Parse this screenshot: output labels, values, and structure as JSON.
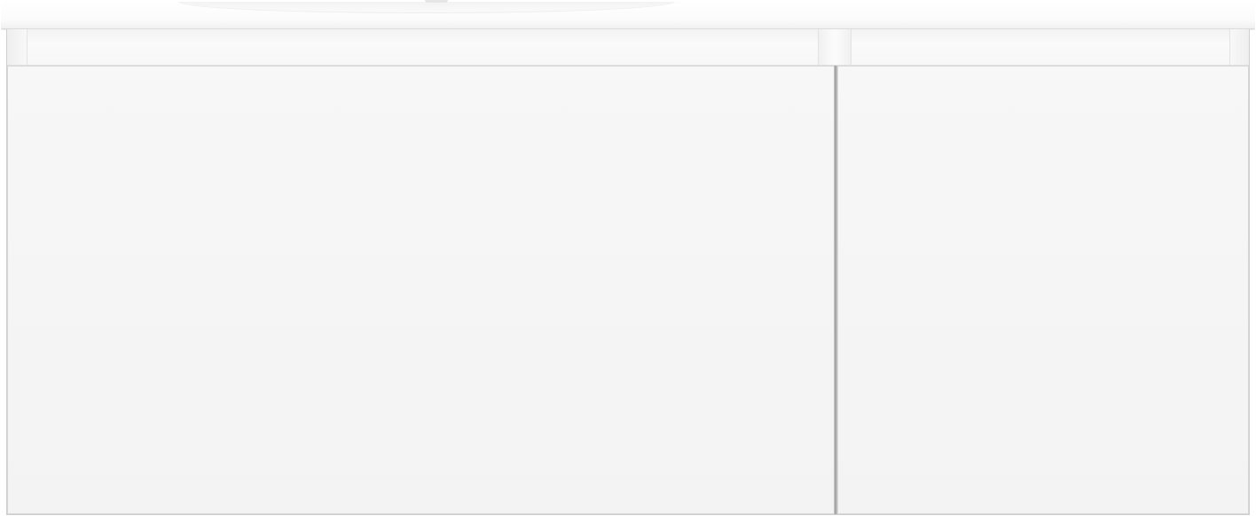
{
  "scene": {
    "subject": "wall-mounted-vanity-cabinet",
    "colors": {
      "background": "#ffffff",
      "countertop": "#fbfbfb",
      "door_face": "#f5f5f5",
      "edge_line": "#d6d6d6",
      "door_gap": "#9a9a9a"
    },
    "door_count": 2,
    "text": ""
  }
}
